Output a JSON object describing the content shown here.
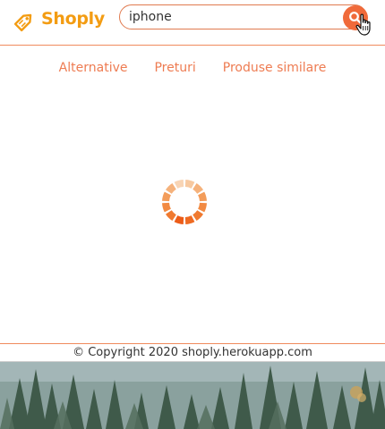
{
  "header": {
    "logo_text": "Shoply",
    "search": {
      "value": "iphone",
      "placeholder": ""
    },
    "search_button_icon": "search-icon"
  },
  "nav": {
    "items": [
      {
        "label": "Alternative"
      },
      {
        "label": "Preturi"
      },
      {
        "label": "Produse similare"
      }
    ]
  },
  "loading": {
    "icon": "spinner-icon"
  },
  "footer": {
    "copyright": "© Copyright 2020 shoply.herokuapp.com"
  },
  "colors": {
    "accent": "#f06a3a",
    "brand": "#f39c12",
    "nav_link": "#ee7c52"
  }
}
